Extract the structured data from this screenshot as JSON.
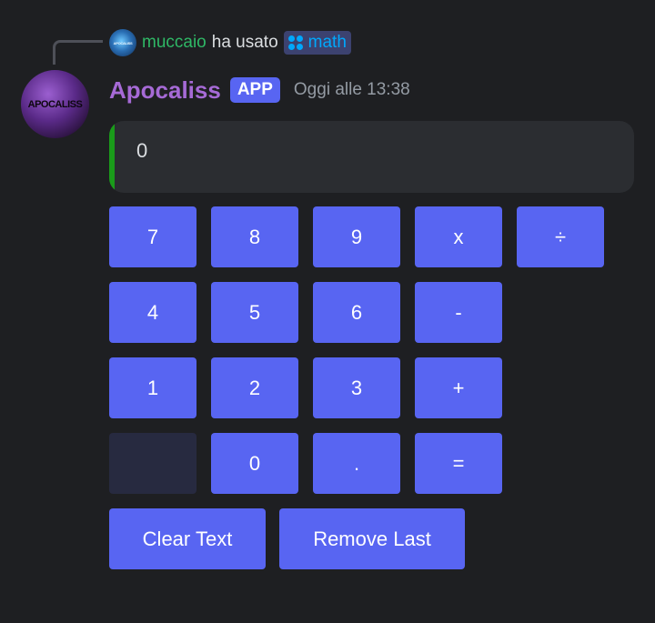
{
  "reply": {
    "avatar_text": "APOCALISS",
    "user": "muccaio",
    "action": "ha usato",
    "command": "math",
    "icon": "slash-command-icon"
  },
  "message": {
    "avatar_text": "APOCALISS",
    "username": "Apocaliss",
    "badge": "APP",
    "timestamp": "Oggi alle 13:38"
  },
  "calculator": {
    "display": "0",
    "keys": {
      "k7": "7",
      "k8": "8",
      "k9": "9",
      "mul": "x",
      "div": "÷",
      "k4": "4",
      "k5": "5",
      "k6": "6",
      "sub": "-",
      "k1": "1",
      "k2": "2",
      "k3": "3",
      "add": "+",
      "blank": "",
      "k0": "0",
      "dot": ".",
      "eq": "="
    },
    "clear_label": "Clear Text",
    "remove_label": "Remove Last"
  },
  "colors": {
    "background": "#1e1f22",
    "blurple": "#5865f2",
    "disabled": "#272a40",
    "display_bg": "#2b2d31",
    "accent_green": "#1a9b1a",
    "username": "#a66ad6",
    "reply_user": "#2fb866"
  }
}
